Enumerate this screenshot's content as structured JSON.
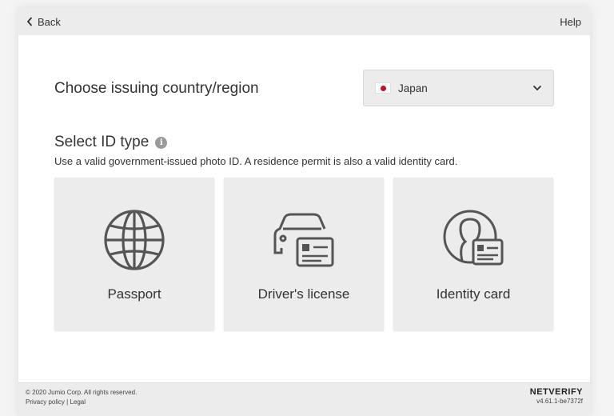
{
  "header": {
    "back_label": "Back",
    "help_label": "Help"
  },
  "country": {
    "title": "Choose issuing country/region",
    "selected": "Japan",
    "flag_icon": "flag-japan-icon"
  },
  "id_type": {
    "title": "Select ID type",
    "info_glyph": "i",
    "description": "Use a valid government-issued photo ID. A residence permit is also a valid identity card.",
    "options": [
      {
        "label": "Passport",
        "icon": "globe-icon"
      },
      {
        "label": "Driver's license",
        "icon": "car-license-icon"
      },
      {
        "label": "Identity card",
        "icon": "person-card-icon"
      }
    ]
  },
  "footer": {
    "copyright": "© 2020 Jumio Corp. All rights reserved.",
    "privacy_label": "Privacy policy",
    "separator": "|",
    "legal_label": "Legal",
    "brand": "NETVERIFY",
    "version": "v4.61.1-be7372f"
  },
  "colors": {
    "background": "#f4f4f4",
    "panel": "#ececec",
    "text": "#333333",
    "icon": "#555555",
    "flag_red": "#c8102e"
  }
}
